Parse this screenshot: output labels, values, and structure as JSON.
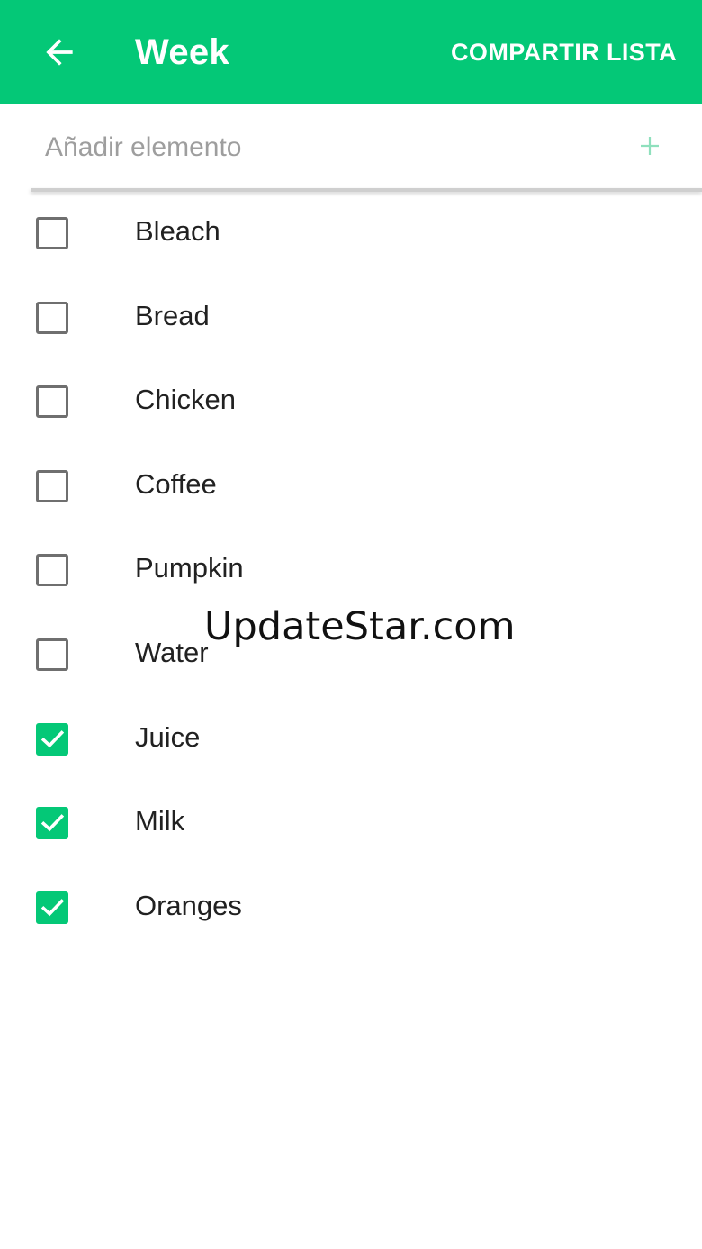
{
  "colors": {
    "accent": "#04c877",
    "checkbox_unchecked": "#6f6f6f",
    "text_primary": "#212121",
    "placeholder": "#9e9e9e"
  },
  "appbar": {
    "back_icon": "arrow-back-icon",
    "title": "Week",
    "share_label": "COMPARTIR LISTA"
  },
  "add_item": {
    "placeholder": "Añadir elemento",
    "value": "",
    "add_icon": "plus-icon"
  },
  "items": [
    {
      "label": "Bleach",
      "checked": false
    },
    {
      "label": "Bread",
      "checked": false
    },
    {
      "label": "Chicken",
      "checked": false
    },
    {
      "label": "Coffee",
      "checked": false
    },
    {
      "label": "Pumpkin",
      "checked": false
    },
    {
      "label": "Water",
      "checked": false
    },
    {
      "label": "Juice",
      "checked": true
    },
    {
      "label": "Milk",
      "checked": true
    },
    {
      "label": "Oranges",
      "checked": true
    }
  ],
  "watermark": "UpdateStar.com"
}
